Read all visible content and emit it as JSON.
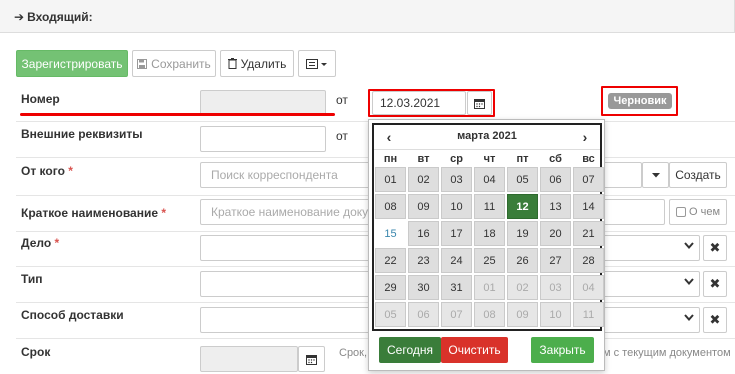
{
  "header": {
    "title": "Входящий:"
  },
  "toolbar": {
    "register_label": "Зарегистрировать",
    "save_label": "Сохранить",
    "delete_label": "Удалить"
  },
  "form": {
    "number_label": "Номер",
    "from_label": "от",
    "date_value": "12.03.2021",
    "status_badge": "Черновик",
    "external_label": "Внешние реквизиты",
    "external_from_label": "от",
    "sender_label": "От кого",
    "sender_placeholder": "Поиск корреспондента",
    "create_label": "Создать",
    "short_name_label": "Краткое наименование",
    "short_name_placeholder": "Краткое наименование докум",
    "about_label": "О чем",
    "case_label": "Дело",
    "type_label": "Тип",
    "delivery_label": "Способ доставки",
    "deadline_label": "Срок",
    "deadline_hint_left": "Срок, у",
    "deadline_hint_right": "м с текущим документом",
    "required_mark": "*"
  },
  "calendar": {
    "title": "марта 2021",
    "prev": "‹",
    "next": "›",
    "weekdays": [
      "пн",
      "вт",
      "ср",
      "чт",
      "пт",
      "сб",
      "вс"
    ],
    "weeks": [
      [
        "01",
        "02",
        "03",
        "04",
        "05",
        "06",
        "07"
      ],
      [
        "08",
        "09",
        "10",
        "11",
        "12",
        "13",
        "14"
      ],
      [
        "15",
        "16",
        "17",
        "18",
        "19",
        "20",
        "21"
      ],
      [
        "22",
        "23",
        "24",
        "25",
        "26",
        "27",
        "28"
      ],
      [
        "29",
        "30",
        "31",
        "01",
        "02",
        "03",
        "04"
      ],
      [
        "05",
        "06",
        "07",
        "08",
        "09",
        "10",
        "11"
      ]
    ],
    "selected_day": "12",
    "today_label": "Сегодня",
    "clear_label": "Очистить",
    "close_label": "Закрыть"
  },
  "colors": {
    "green": "#5cb85c",
    "selected": "#3a7d3a",
    "red": "#e00000",
    "clear_red": "#d9322a"
  }
}
